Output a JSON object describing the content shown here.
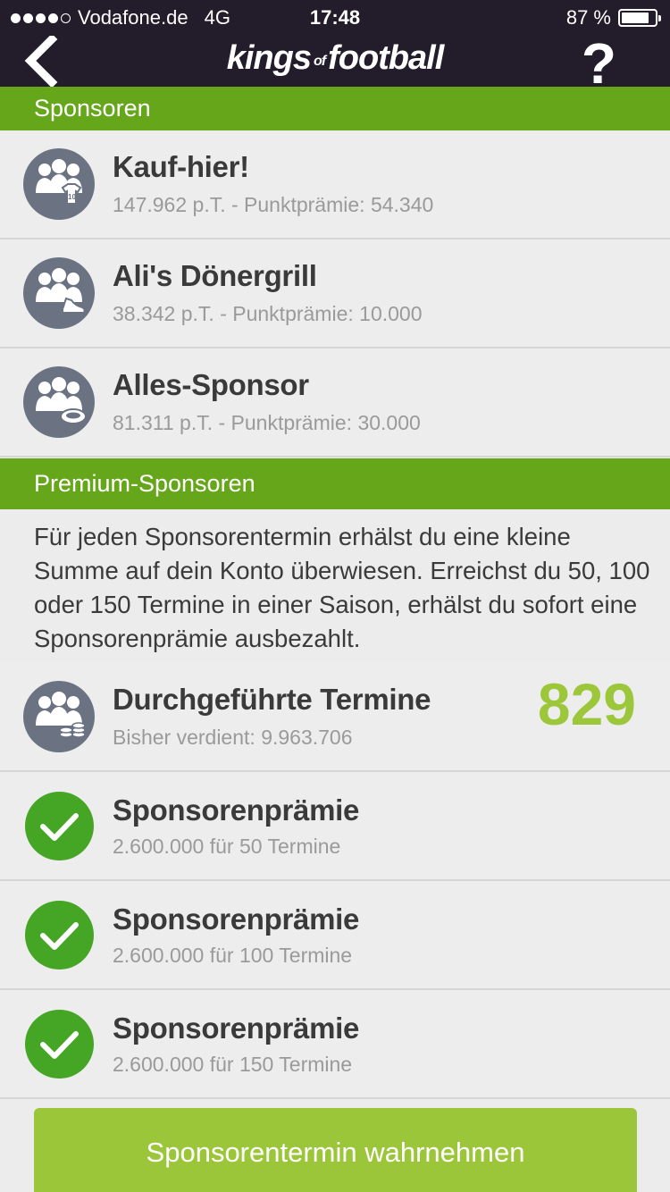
{
  "status_bar": {
    "carrier": "Vodafone.de",
    "network": "4G",
    "time": "17:48",
    "battery": "87 %"
  },
  "nav": {
    "logo_left": "kings",
    "logo_mid": "of",
    "logo_right": "football",
    "help": "?"
  },
  "sponsors": {
    "header": "Sponsoren",
    "items": [
      {
        "name": "Kauf-hier!",
        "detail": "147.962 p.T. - Punktprämie: 54.340"
      },
      {
        "name": "Ali's Dönergrill",
        "detail": "38.342 p.T. - Punktprämie: 10.000"
      },
      {
        "name": "Alles-Sponsor",
        "detail": "81.311 p.T. - Punktprämie: 30.000"
      }
    ]
  },
  "premium": {
    "header": "Premium-Sponsoren",
    "description": "Für jeden Sponsorentermin erhälst du eine kleine Summe auf dein Konto überwiesen. Erreichst du 50, 100 oder 150 Termine in einer Saison, erhälst du sofort eine Sponsorenprämie ausbezahlt.",
    "completed": {
      "title": "Durchgeführte Termine",
      "earned": "Bisher verdient: 9.963.706",
      "count": "829"
    },
    "bonuses": [
      {
        "title": "Sponsorenprämie",
        "detail": "2.600.000 für 50 Termine"
      },
      {
        "title": "Sponsorenprämie",
        "detail": "2.600.000 für 100 Termine"
      },
      {
        "title": "Sponsorenprämie",
        "detail": "2.600.000 für 150 Termine"
      }
    ]
  },
  "cta": {
    "label": "Sponsorentermin wahrnehmen"
  },
  "colors": {
    "accent_green": "#65a61b",
    "count_green": "#9dc73a",
    "check_green": "#45a625",
    "nav_dark": "#231d2b"
  }
}
